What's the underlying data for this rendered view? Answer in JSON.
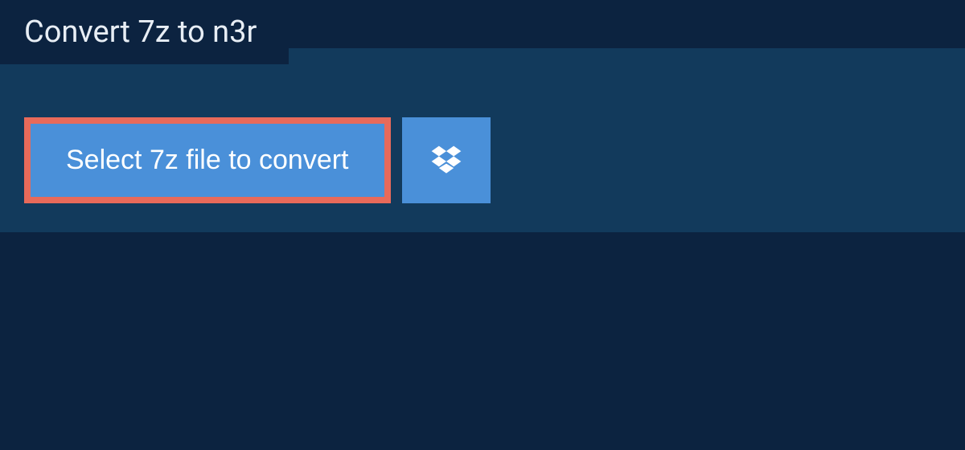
{
  "header": {
    "title": "Convert 7z to n3r"
  },
  "actions": {
    "select_file_label": "Select 7z file to convert"
  }
}
